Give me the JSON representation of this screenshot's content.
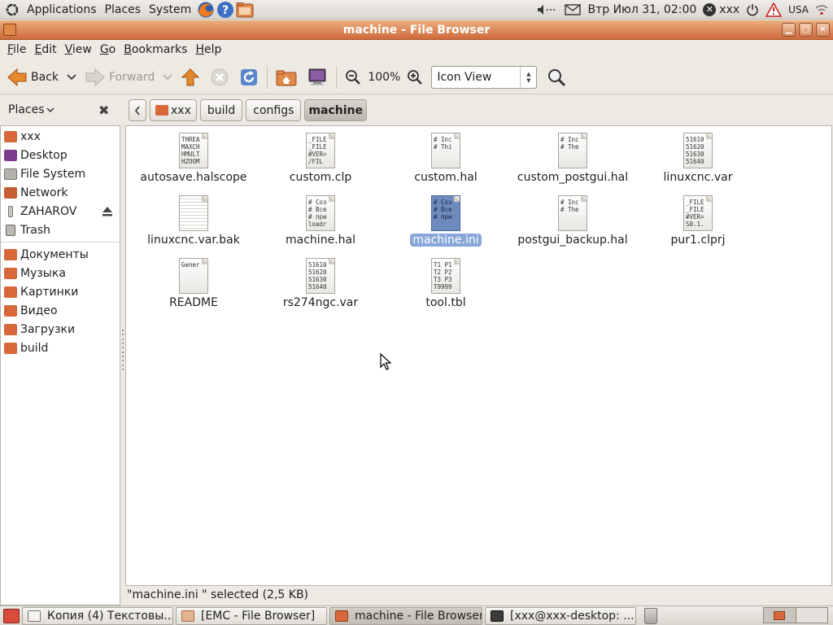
{
  "top_panel": {
    "menus": [
      "Applications",
      "Places",
      "System"
    ],
    "clock": "Втр Июл 31, 02:00",
    "user": "xxx",
    "keyboard_layout": "USA"
  },
  "window": {
    "title": "machine - File Browser",
    "menu": [
      {
        "label": "File",
        "mnemonic": "F",
        "rest": "ile"
      },
      {
        "label": "Edit",
        "mnemonic": "E",
        "rest": "dit"
      },
      {
        "label": "View",
        "mnemonic": "V",
        "rest": "iew"
      },
      {
        "label": "Go",
        "mnemonic": "G",
        "rest": "o"
      },
      {
        "label": "Bookmarks",
        "mnemonic": "B",
        "rest": "ookmarks"
      },
      {
        "label": "Help",
        "mnemonic": "H",
        "rest": "elp"
      }
    ]
  },
  "toolbar": {
    "back_label": "Back",
    "forward_label": "Forward",
    "zoom_level": "100%",
    "view_mode": "Icon View"
  },
  "sidebar": {
    "header": "Places",
    "items": [
      {
        "label": "xxx",
        "icon": "home-folder-icon",
        "color": "#d8683a"
      },
      {
        "label": "Desktop",
        "icon": "desktop-icon",
        "color": "#7d3b8c"
      },
      {
        "label": "File System",
        "icon": "drive-icon",
        "color": "#9a9690"
      },
      {
        "label": "Network",
        "icon": "network-icon",
        "color": "#c75e33"
      },
      {
        "label": "ZAHAROV",
        "icon": "usb-drive-icon",
        "color": "#8a8780"
      },
      {
        "label": "Trash",
        "icon": "trash-icon",
        "color": "#8a8780"
      }
    ],
    "bookmarks": [
      {
        "label": "Документы",
        "icon": "folder-icon",
        "color": "#d8683a"
      },
      {
        "label": "Музыка",
        "icon": "folder-icon",
        "color": "#d8683a"
      },
      {
        "label": "Картинки",
        "icon": "folder-icon",
        "color": "#d8683a"
      },
      {
        "label": "Видео",
        "icon": "folder-icon",
        "color": "#d8683a"
      },
      {
        "label": "Загрузки",
        "icon": "folder-icon",
        "color": "#d8683a"
      },
      {
        "label": "build",
        "icon": "folder-icon",
        "color": "#d8683a"
      }
    ]
  },
  "path": {
    "crumbs": [
      "xxx",
      "build",
      "configs",
      "machine"
    ],
    "active": "machine"
  },
  "files": [
    {
      "name": "autosave.halscope",
      "preview": "THREA\nMAXCH\nHMULT\nHZOOM"
    },
    {
      "name": "custom.clp",
      "preview": "_FILE\n_FILE\n#VER=\n/FIL"
    },
    {
      "name": "custom.hal",
      "preview": "# Inc\n# Thi"
    },
    {
      "name": "custom_postgui.hal",
      "preview": "# Inc\n# The"
    },
    {
      "name": "linuxcnc.var",
      "preview": "51610\n51620\n51630\n51640"
    },
    {
      "name": "linuxcnc.var.bak",
      "preview": ""
    },
    {
      "name": "machine.hal",
      "preview": "# Соз\n# Все\n# при\nloadr"
    },
    {
      "name": "machine.ini",
      "preview": "# Соз\n# Все\n# при",
      "selected": true
    },
    {
      "name": "postgui_backup.hal",
      "preview": "# Inc\n# The"
    },
    {
      "name": "pur1.clprj",
      "preview": "_FILE\n_FILE\n#VER=\nS0.1."
    },
    {
      "name": "README",
      "preview": "Gener"
    },
    {
      "name": "rs274ngc.var",
      "preview": "51610\n51620\n51630\n51640"
    },
    {
      "name": "tool.tbl",
      "preview": "T1 P1\nT2 P2\nT3 P3\nT9999"
    }
  ],
  "status": "\"machine.ini \" selected (2,5 KB)",
  "taskbar": [
    {
      "label": "Копия (4) Текстовы...",
      "icon": "text-editor-icon",
      "active": false
    },
    {
      "label": "[EMC - File Browser]",
      "icon": "folder-icon",
      "active": false
    },
    {
      "label": "machine - File Browser",
      "icon": "folder-icon",
      "active": true
    },
    {
      "label": "[xxx@xxx-desktop: ...",
      "icon": "terminal-icon",
      "active": false
    }
  ],
  "colors": {
    "accent": "#d0693c",
    "selection": "#86a7d8"
  }
}
